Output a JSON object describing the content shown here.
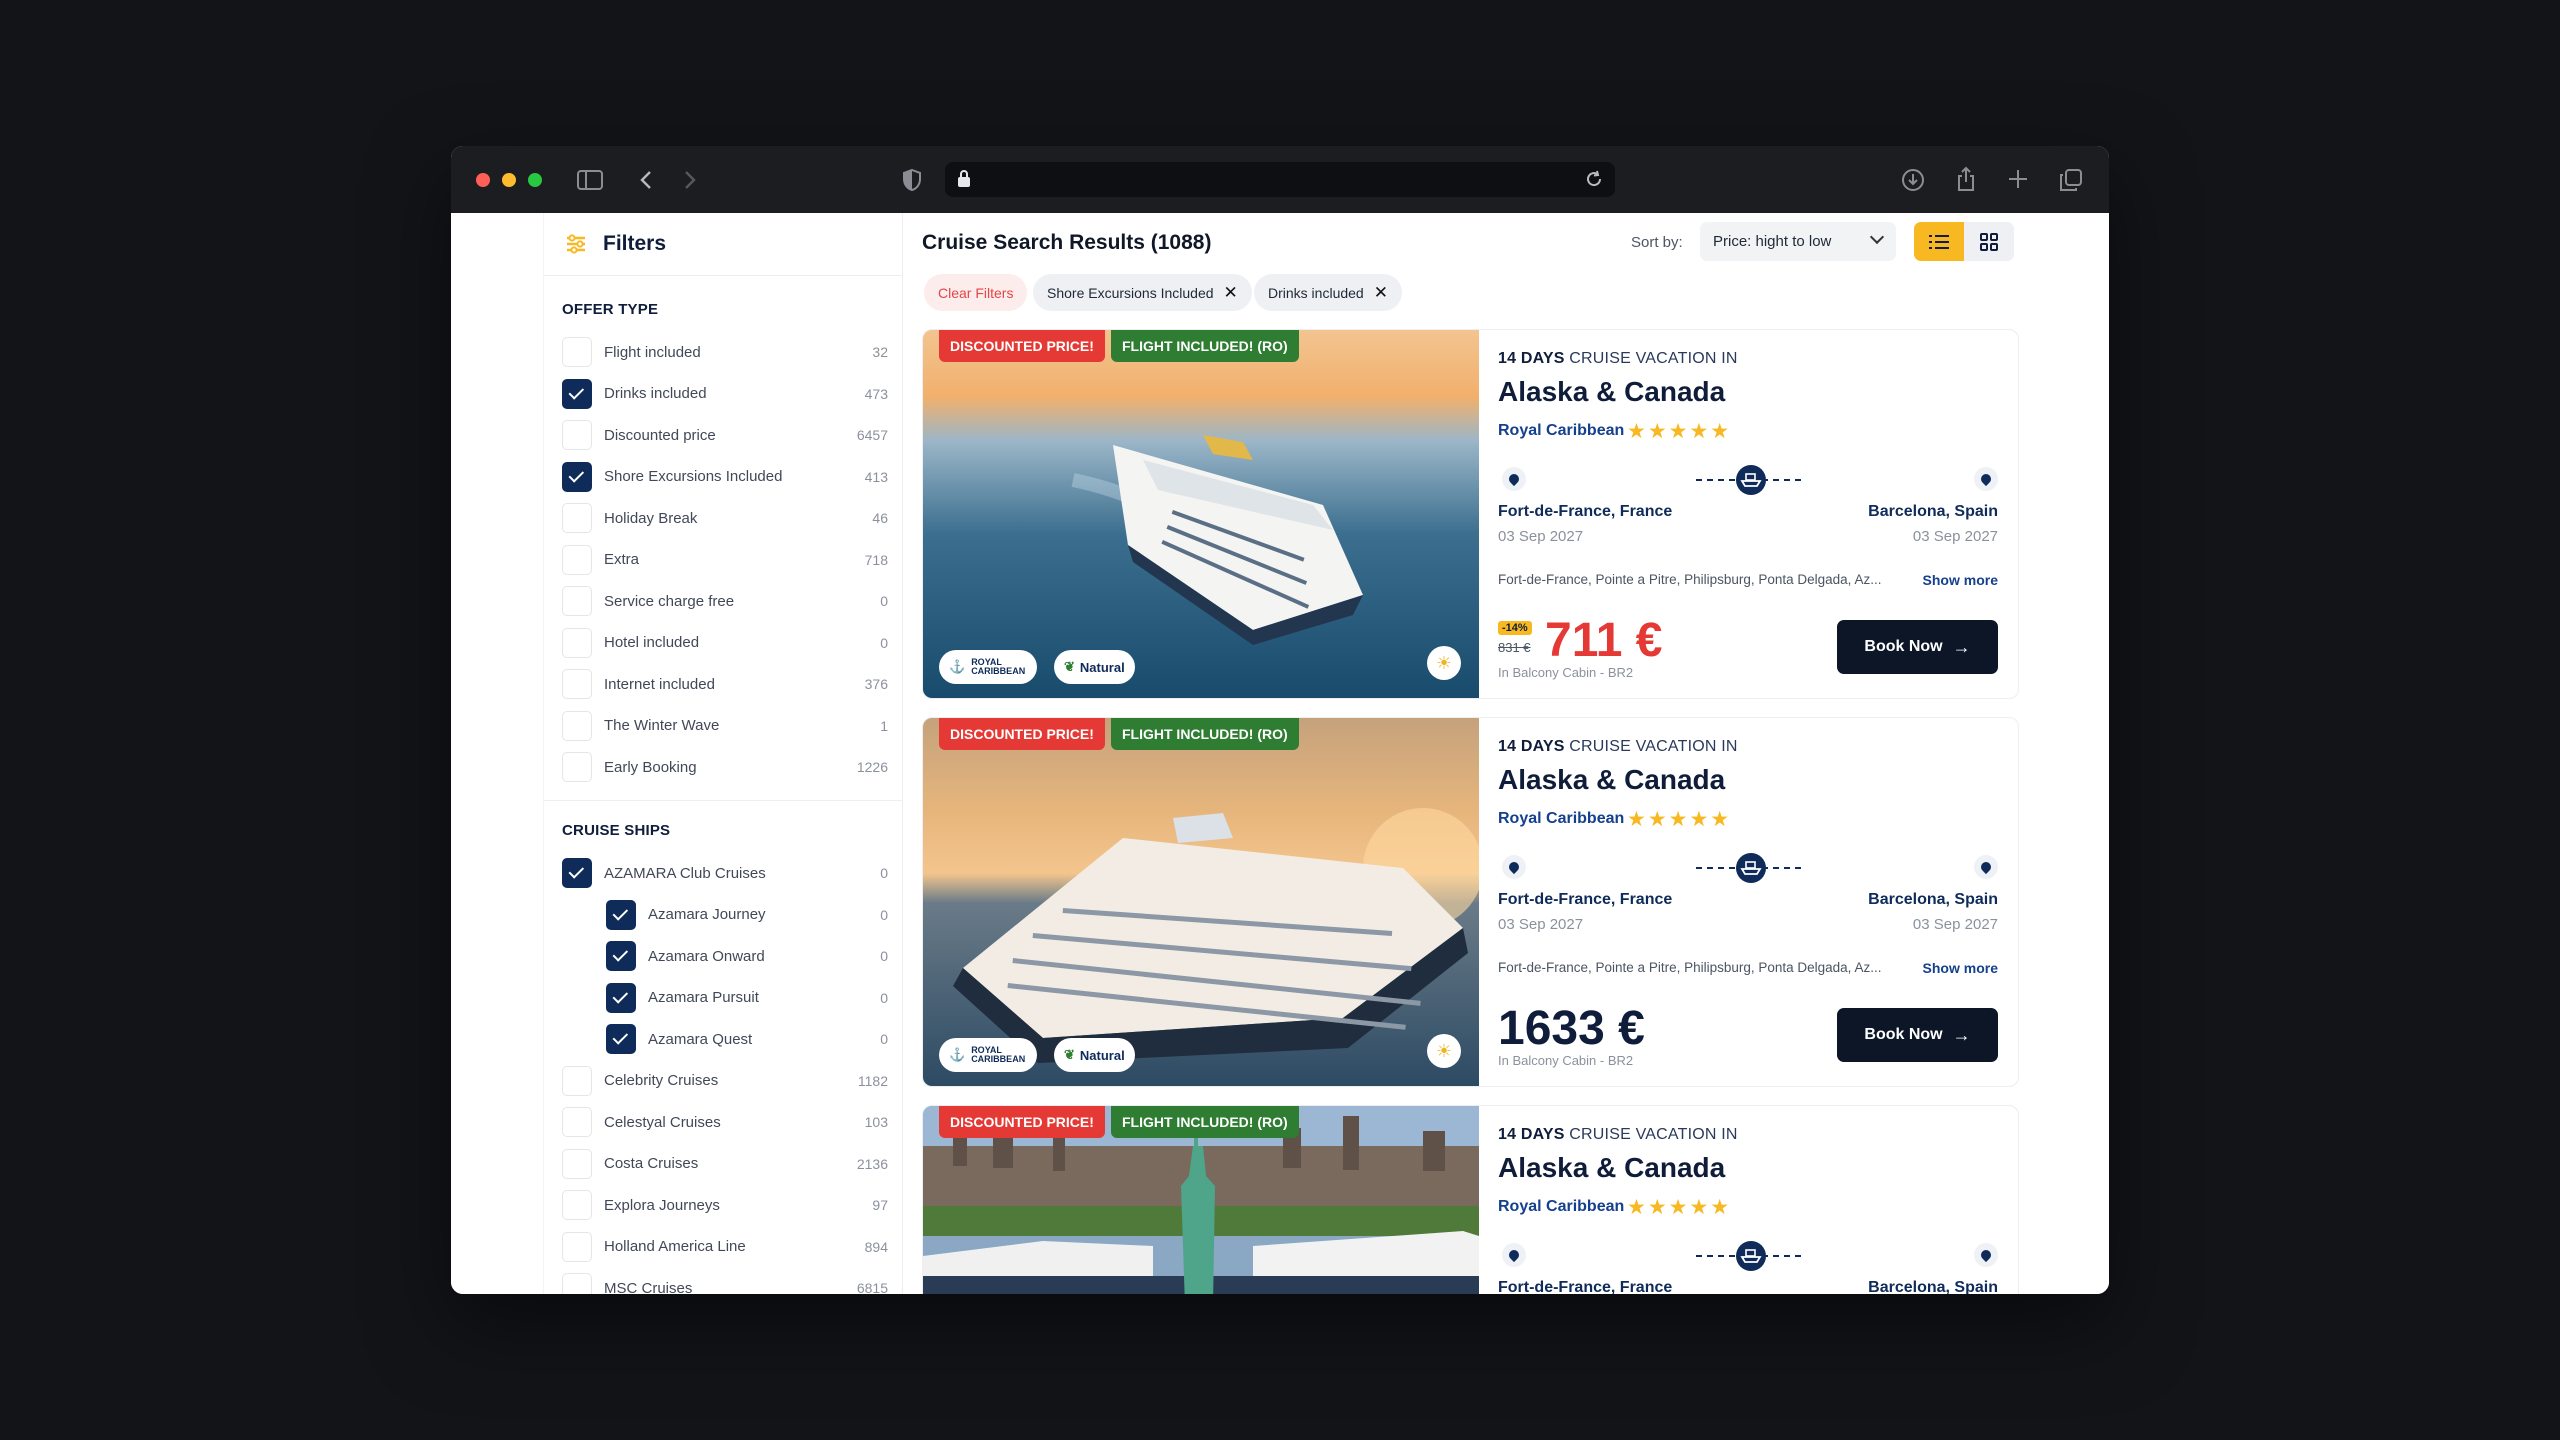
{
  "browser": {
    "traffic_lights": [
      "#ff5f57",
      "#febc2e",
      "#28c840"
    ]
  },
  "filters": {
    "title": "Filters",
    "offer_type_title": "OFFER TYPE",
    "offer_types": [
      {
        "label": "Flight included",
        "count": "32",
        "checked": false
      },
      {
        "label": "Drinks included",
        "count": "473",
        "checked": true
      },
      {
        "label": "Discounted price",
        "count": "6457",
        "checked": false
      },
      {
        "label": "Shore Excursions Included",
        "count": "413",
        "checked": true
      },
      {
        "label": "Holiday Break",
        "count": "46",
        "checked": false
      },
      {
        "label": "Extra",
        "count": "718",
        "checked": false
      },
      {
        "label": "Service charge free",
        "count": "0",
        "checked": false
      },
      {
        "label": "Hotel included",
        "count": "0",
        "checked": false
      },
      {
        "label": "Internet included",
        "count": "376",
        "checked": false
      },
      {
        "label": "The Winter Wave",
        "count": "1",
        "checked": false
      },
      {
        "label": "Early Booking",
        "count": "1226",
        "checked": false
      }
    ],
    "cruise_ships_title": "CRUISE SHIPS",
    "cruise_ships": [
      {
        "label": "AZAMARA Club Cruises",
        "count": "0",
        "checked": true,
        "indent": false
      },
      {
        "label": "Azamara Journey",
        "count": "0",
        "checked": true,
        "indent": true
      },
      {
        "label": "Azamara Onward",
        "count": "0",
        "checked": true,
        "indent": true
      },
      {
        "label": "Azamara Pursuit",
        "count": "0",
        "checked": true,
        "indent": true
      },
      {
        "label": "Azamara Quest",
        "count": "0",
        "checked": true,
        "indent": true
      },
      {
        "label": "Celebrity Cruises",
        "count": "1182",
        "checked": false,
        "indent": false
      },
      {
        "label": "Celestyal Cruises",
        "count": "103",
        "checked": false,
        "indent": false
      },
      {
        "label": "Costa Cruises",
        "count": "2136",
        "checked": false,
        "indent": false
      },
      {
        "label": "Explora Journeys",
        "count": "97",
        "checked": false,
        "indent": false
      },
      {
        "label": "Holland America Line",
        "count": "894",
        "checked": false,
        "indent": false
      },
      {
        "label": "MSC Cruises",
        "count": "6815",
        "checked": false,
        "indent": false
      }
    ]
  },
  "results": {
    "title": "Cruise Search Results (1088)",
    "sort_label": "Sort by:",
    "sort_value": "Price: hight to low",
    "view_mode": "list",
    "clear_filters": "Clear Filters",
    "active_filters": [
      "Shore Excursions Included",
      "Drinks included"
    ],
    "accent_color": "#f7b822",
    "cards": [
      {
        "badge_discount": "DISCOUNTED PRICE!",
        "badge_flight": "FLIGHT INCLUDED! (RO)",
        "logo_text": "ROYAL CARIBBEAN",
        "natural_label": "Natural",
        "days": "14 DAYS",
        "days_suffix": "CRUISE VACATION IN",
        "destination": "Alaska & Canada",
        "cruise_line": "Royal Caribbean",
        "stars": "★★★★★",
        "from_port": "Fort-de-France, France",
        "from_date": "03 Sep 2027",
        "to_port": "Barcelona, Spain",
        "to_date": "03 Sep 2027",
        "ports": "Fort-de-France, Pointe a Pitre, Philipsburg, Ponta Delgada, Az...",
        "show_more": "Show more",
        "discount_pct": "-14%",
        "old_price": "831 €",
        "price": "711 €",
        "cabin": "In Balcony Cabin - BR2",
        "book_label": "Book Now"
      },
      {
        "badge_discount": "DISCOUNTED PRICE!",
        "badge_flight": "FLIGHT INCLUDED! (RO)",
        "logo_text": "ROYAL CARIBBEAN",
        "natural_label": "Natural",
        "days": "14 DAYS",
        "days_suffix": "CRUISE VACATION IN",
        "destination": "Alaska & Canada",
        "cruise_line": "Royal Caribbean",
        "stars": "★★★★★",
        "from_port": "Fort-de-France, France",
        "from_date": "03 Sep 2027",
        "to_port": "Barcelona, Spain",
        "to_date": "03 Sep 2027",
        "ports": "Fort-de-France, Pointe a Pitre, Philipsburg, Ponta Delgada, Az...",
        "show_more": "Show more",
        "price": "1633 €",
        "cabin": "In Balcony Cabin - BR2",
        "book_label": "Book Now"
      },
      {
        "badge_discount": "DISCOUNTED PRICE!",
        "badge_flight": "FLIGHT INCLUDED! (RO)",
        "days": "14 DAYS",
        "days_suffix": "CRUISE VACATION IN",
        "destination": "Alaska & Canada",
        "cruise_line": "Royal Caribbean",
        "stars": "★★★★★",
        "from_port": "Fort-de-France, France",
        "to_port": "Barcelona, Spain"
      }
    ]
  }
}
